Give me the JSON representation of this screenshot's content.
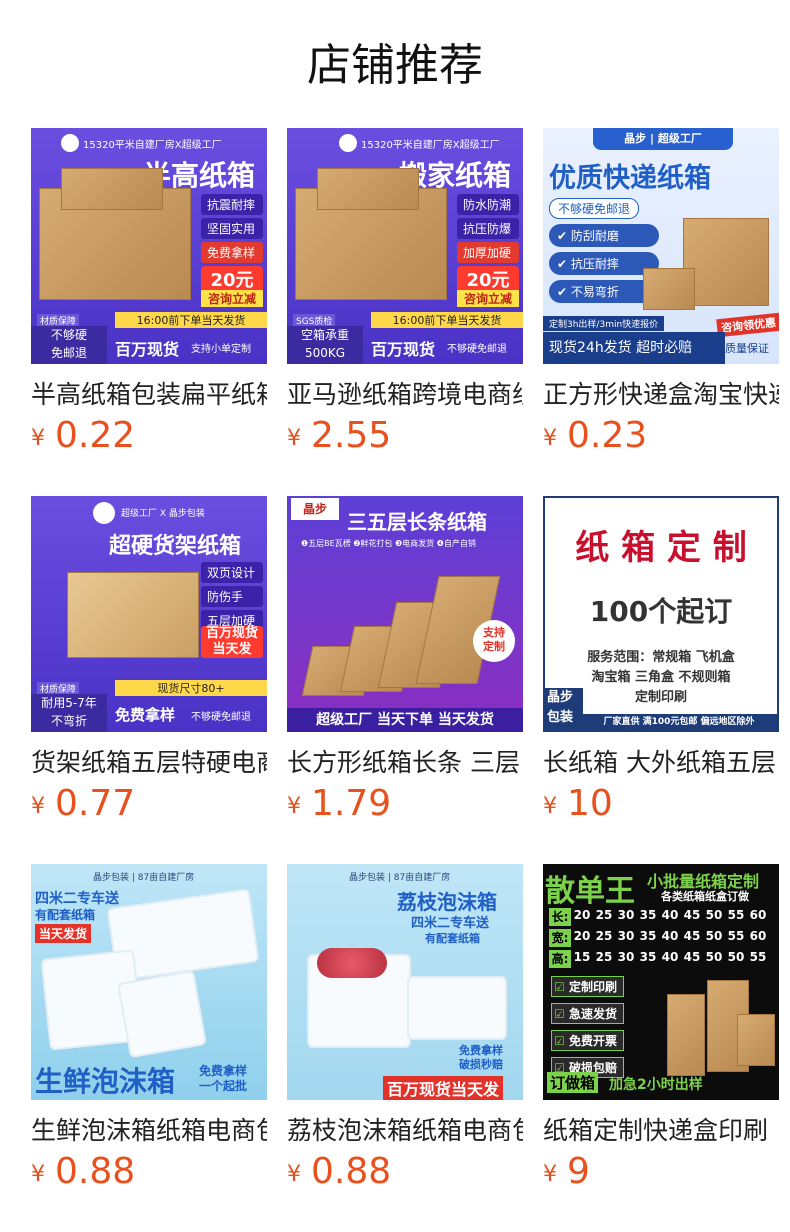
{
  "page_title": "店铺推荐",
  "products": [
    {
      "name": "半高纸箱包装扁平纸箱",
      "price": "0.22",
      "img": {
        "header": "15320平米自建厂房X超级工厂",
        "title": "半高纸箱",
        "tags": [
          "抗震耐摔",
          "坚固实用",
          "免费拿样"
        ],
        "badge_price": "20元",
        "badge_sub": "咨询立减",
        "strip_right": "16:00前下单当天发货",
        "bottom_left_tag": "材质保障",
        "bottom_left": "不够硬\n免邮退",
        "bottom_main": "百万现货",
        "bottom_small": "支持小单定制"
      }
    },
    {
      "name": "亚马逊纸箱跨境电商纸箱",
      "price": "2.55",
      "img": {
        "header": "15320平米自建厂房X超级工厂",
        "title": "搬家纸箱",
        "tags": [
          "防水防潮",
          "抗压防爆",
          "加厚加硬"
        ],
        "badge_price": "20元",
        "badge_sub": "咨询立减",
        "strip_right": "16:00前下单当天发货",
        "bottom_left_tag": "SGS质检",
        "bottom_left": "空箱承重\n500KG",
        "bottom_main": "百万现货",
        "bottom_small": "不够硬免邮退"
      }
    },
    {
      "name": "正方形快递盒淘宝快递",
      "price": "0.23",
      "img": {
        "brands": "晶步 | 超级工厂",
        "title": "优质快递纸箱",
        "sub": "不够硬免邮退",
        "checks": [
          "防刮耐磨",
          "抗压耐摔",
          "不易弯折"
        ],
        "strip": "定制3h出样/3min快速报价",
        "corner": "咨询领优惠",
        "bottom_main": "现货24h发货 超时必赔",
        "bottom_tag": "质量保证"
      }
    },
    {
      "name": "货架纸箱五层特硬电商",
      "price": "0.77",
      "img": {
        "header": "超级工厂 X 晶步包装",
        "title": "超硬货架纸箱",
        "tags": [
          "双页设计",
          "防伤手",
          "五层加硬"
        ],
        "red": "百万现货\n当天发",
        "bottom_left_tag": "材质保障",
        "bottom_left": "耐用5-7年\n不弯折",
        "strip_right": "现货尺寸80+",
        "bottom_main": "免费拿样",
        "bottom_small": "不够硬免邮退"
      }
    },
    {
      "name": "长方形纸箱长条 三层",
      "price": "1.79",
      "img": {
        "logo": "晶步",
        "logo_sub": "JINGBU",
        "title": "三五层长条纸箱",
        "features": "❶五层BE瓦楞 ❷鲜花打包 ❸电商发货 ❹自产自销",
        "seal": "支持\n定制",
        "bottom": "超级工厂  当天下单 当天发货"
      }
    },
    {
      "name": "长纸箱 大外纸箱五层",
      "price": "10",
      "img": {
        "title": "纸 箱 定 制",
        "sub": "100个起订",
        "desc": "服务范围：常规箱 飞机盒\n淘宝箱 三角盒 不规则箱\n定制印刷",
        "corner": "晶步\n包装",
        "bottom": "厂家直供 满100元包邮 偏远地区除外"
      }
    },
    {
      "name": "生鲜泡沫箱纸箱电商包",
      "price": "0.88",
      "img": {
        "header": "晶步包装 | 87亩自建厂房",
        "lines": [
          "四米二专车送",
          "有配套纸箱"
        ],
        "red": "当天发货",
        "title": "生鲜泡沫箱",
        "side": "免费拿样\n一个起批"
      }
    },
    {
      "name": "荔枝泡沫箱纸箱电商包",
      "price": "0.88",
      "img": {
        "header": "晶步包装 | 87亩自建厂房",
        "title": "荔枝泡沫箱",
        "lines": [
          "四米二专车送",
          "有配套纸箱"
        ],
        "side": "免费拿样\n破损秒赔",
        "bottom": "百万现货当天发"
      }
    },
    {
      "name": "纸箱定制快递盒印刷",
      "price": "9",
      "img": {
        "title": "散单王",
        "right_title": "小批量纸箱定制",
        "right_sub": "各类纸箱纸盒订做",
        "rows": [
          {
            "label": "长:",
            "vals": [
              "20",
              "25",
              "30",
              "35",
              "40",
              "45",
              "50",
              "55",
              "60"
            ]
          },
          {
            "label": "宽:",
            "vals": [
              "20",
              "25",
              "30",
              "35",
              "40",
              "45",
              "50",
              "55",
              "60"
            ]
          },
          {
            "label": "高:",
            "vals": [
              "15",
              "25",
              "30",
              "35",
              "40",
              "45",
              "50",
              "50",
              "55"
            ]
          }
        ],
        "checks": [
          "定制印刷",
          "急速发货",
          "免费开票",
          "破损包赔"
        ],
        "bottom_tag": "订做箱",
        "bottom": "加急2小时出样"
      }
    }
  ],
  "currency": "¥",
  "colors": {
    "price": "#e8501d",
    "purple": "#5a33c8",
    "blue": "#1f5fc6",
    "green": "#7cd24a"
  }
}
